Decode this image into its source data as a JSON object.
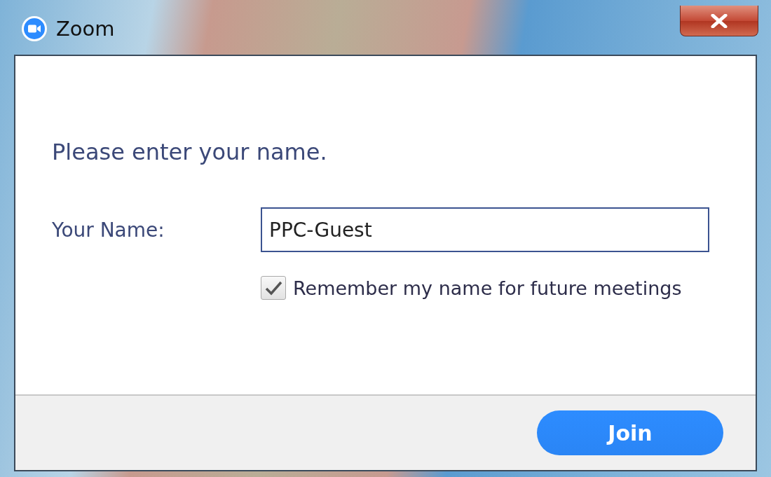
{
  "window": {
    "title": "Zoom"
  },
  "prompt": "Please enter your name.",
  "name_field": {
    "label": "Your Name:",
    "value": "PPC-Guest"
  },
  "remember": {
    "label": "Remember my name for future meetings",
    "checked": true
  },
  "buttons": [
    {
      "label": "Join",
      "kind": "primary"
    }
  ]
}
